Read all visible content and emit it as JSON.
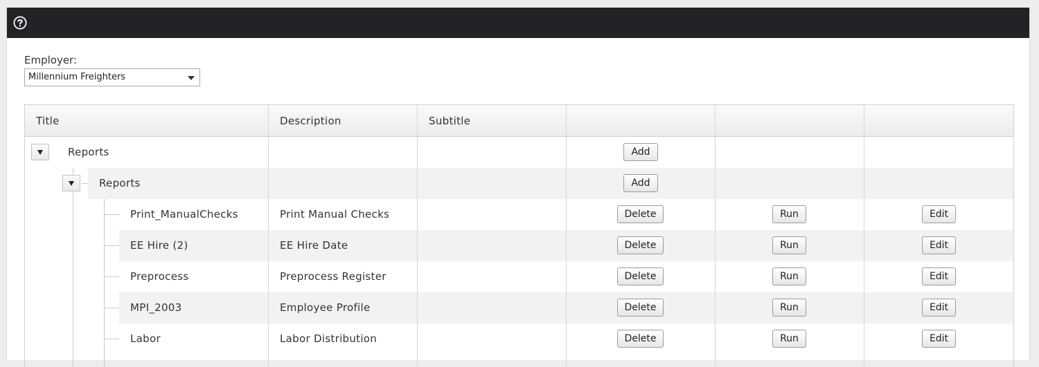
{
  "toolbar": {
    "help_icon": "help-circle-icon",
    "bar_color": "#222326"
  },
  "employer": {
    "label": "Employer:",
    "selected": "Millennium Freighters"
  },
  "grid": {
    "columns": [
      "Title",
      "Description",
      "Subtitle",
      "",
      "",
      ""
    ],
    "root": {
      "title": "Reports",
      "add_label": "Add"
    },
    "folder": {
      "title": "Reports",
      "add_label": "Add"
    },
    "items": [
      {
        "title": "Print_ManualChecks",
        "description": "Print Manual Checks",
        "subtitle": "",
        "delete_label": "Delete",
        "run_label": "Run",
        "edit_label": "Edit"
      },
      {
        "title": "EE Hire (2)",
        "description": "EE Hire Date",
        "subtitle": "",
        "delete_label": "Delete",
        "run_label": "Run",
        "edit_label": "Edit"
      },
      {
        "title": "Preprocess",
        "description": "Preprocess Register",
        "subtitle": "",
        "delete_label": "Delete",
        "run_label": "Run",
        "edit_label": "Edit"
      },
      {
        "title": "MPI_2003",
        "description": "Employee Profile",
        "subtitle": "",
        "delete_label": "Delete",
        "run_label": "Run",
        "edit_label": "Edit"
      },
      {
        "title": "Labor",
        "description": "Labor Distribution",
        "subtitle": "",
        "delete_label": "Delete",
        "run_label": "Run",
        "edit_label": "Edit"
      }
    ]
  }
}
